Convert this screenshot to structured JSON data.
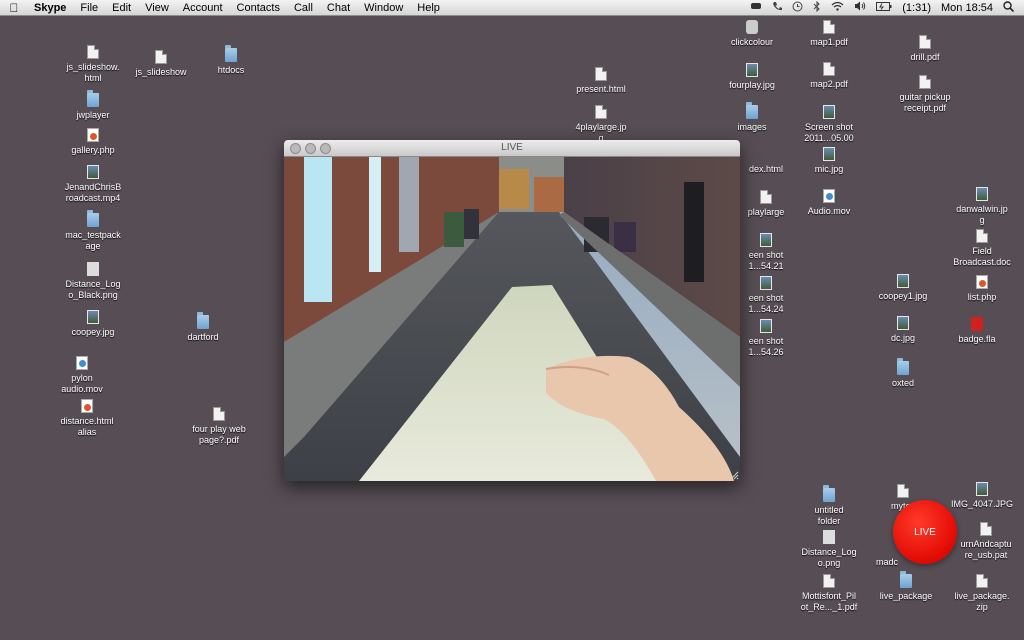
{
  "menubar": {
    "app_name": "Skype",
    "menus": [
      "File",
      "Edit",
      "View",
      "Account",
      "Contacts",
      "Call",
      "Chat",
      "Window",
      "Help"
    ],
    "battery": "(1:31)",
    "clock": "Mon 18:54"
  },
  "window": {
    "title": "LIVE"
  },
  "live_badge": "LIVE",
  "desktop": {
    "left": [
      {
        "label": "js_slideshow.\nhtml",
        "icon": "doc"
      },
      {
        "label": "js_slideshow",
        "icon": "doc"
      },
      {
        "label": "htdocs",
        "icon": "folder"
      },
      {
        "label": "jwplayer",
        "icon": "folder"
      },
      {
        "label": "gallery.php",
        "icon": "php"
      },
      {
        "label": "JenandChrisB\nroadcast.mp4",
        "icon": "img"
      },
      {
        "label": "mac_testpack\nage",
        "icon": "folder"
      },
      {
        "label": "Distance_Log\no_Black.png",
        "icon": "line"
      },
      {
        "label": "coopey.jpg",
        "icon": "img"
      },
      {
        "label": "dartford",
        "icon": "folder"
      },
      {
        "label": "pylon\naudio.mov",
        "icon": "mov"
      },
      {
        "label": "distance.html\nalias",
        "icon": "php"
      },
      {
        "label": "four play web\npage?.pdf",
        "icon": "doc"
      }
    ],
    "middle": [
      {
        "label": "present.html",
        "icon": "doc"
      },
      {
        "label": "4playlarge.jp\ng",
        "icon": "doc"
      }
    ],
    "right": [
      {
        "label": "clickcolour",
        "icon": "app"
      },
      {
        "label": "map1.pdf",
        "icon": "doc"
      },
      {
        "label": "drill.pdf",
        "icon": "doc"
      },
      {
        "label": "fourplay.jpg",
        "icon": "img"
      },
      {
        "label": "map2.pdf",
        "icon": "doc"
      },
      {
        "label": "guitar pickup\nreceipt.pdf",
        "icon": "doc"
      },
      {
        "label": "images",
        "icon": "folder"
      },
      {
        "label": "Screen shot\n2011...05.00",
        "icon": "img"
      },
      {
        "label": "dex.html",
        "icon": "doc"
      },
      {
        "label": "mic.jpg",
        "icon": "img"
      },
      {
        "label": "playlarge",
        "icon": "doc"
      },
      {
        "label": "Audio.mov",
        "icon": "mov"
      },
      {
        "label": "danwalwin.jp\ng",
        "icon": "img"
      },
      {
        "label": "een shot\n1...54.21",
        "icon": "img"
      },
      {
        "label": "Field\nBroadcast.doc",
        "icon": "doc"
      },
      {
        "label": "coopey1.jpg",
        "icon": "img"
      },
      {
        "label": "list.php",
        "icon": "php"
      },
      {
        "label": "een shot\n1...54.24",
        "icon": "img"
      },
      {
        "label": "dc.jpg",
        "icon": "img"
      },
      {
        "label": "badge.fla",
        "icon": "fla"
      },
      {
        "label": "een shot\n1...54.26",
        "icon": "img"
      },
      {
        "label": "oxted",
        "icon": "folder"
      },
      {
        "label": "untitled\nfolder",
        "icon": "folder"
      },
      {
        "label": "mytex",
        "icon": "doc"
      },
      {
        "label": "IMG_4047.JPG",
        "icon": "img"
      },
      {
        "label": "madc",
        "icon": "doc"
      },
      {
        "label": "urnAndcaptu\nre_usb.pat",
        "icon": "doc"
      },
      {
        "label": "Distance_Log\no.png",
        "icon": "line"
      },
      {
        "label": "Mottisfont_Pil\not_Re..._1.pdf",
        "icon": "doc"
      },
      {
        "label": "live_package",
        "icon": "folder"
      },
      {
        "label": "live_package.\nzip",
        "icon": "doc"
      }
    ]
  }
}
